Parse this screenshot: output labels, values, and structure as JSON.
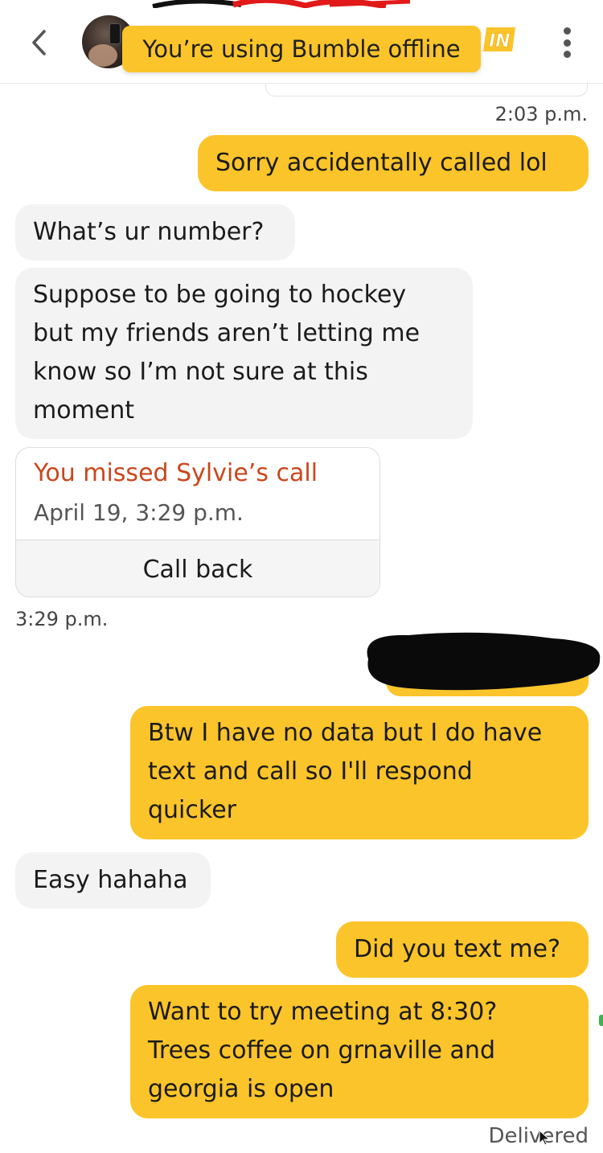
{
  "header": {
    "offline_banner": "You’re using Bumble offline",
    "badge_text": "IN"
  },
  "colors": {
    "bumble_yellow": "#fbc42a",
    "incoming_bubble": "#f3f3f3",
    "missed_call_red": "#c9471c"
  },
  "messages": {
    "ts1": "2:03 p.m.",
    "m1": "Sorry accidentally called lol",
    "m2": "What’s ur number?",
    "m3_lines": [
      "Suppose to be going to hockey",
      "but my friends aren’t letting me",
      "know so I’m not sure at this",
      "moment"
    ],
    "call_title": "You missed Sylvie’s call",
    "call_date": "April 19, 3:29 p.m.",
    "call_back": "Call back",
    "ts2": "3:29 p.m.",
    "m4_lines": [
      "Btw I have no data but I do have",
      "text and call so I'll respond",
      "quicker"
    ],
    "m5": "Easy hahaha",
    "m6": "Did you text me?",
    "m7_lines": [
      "Want to try meeting at 8:30?",
      "Trees coffee on grnaville and",
      "georgia is open"
    ],
    "status": "Delivered"
  }
}
